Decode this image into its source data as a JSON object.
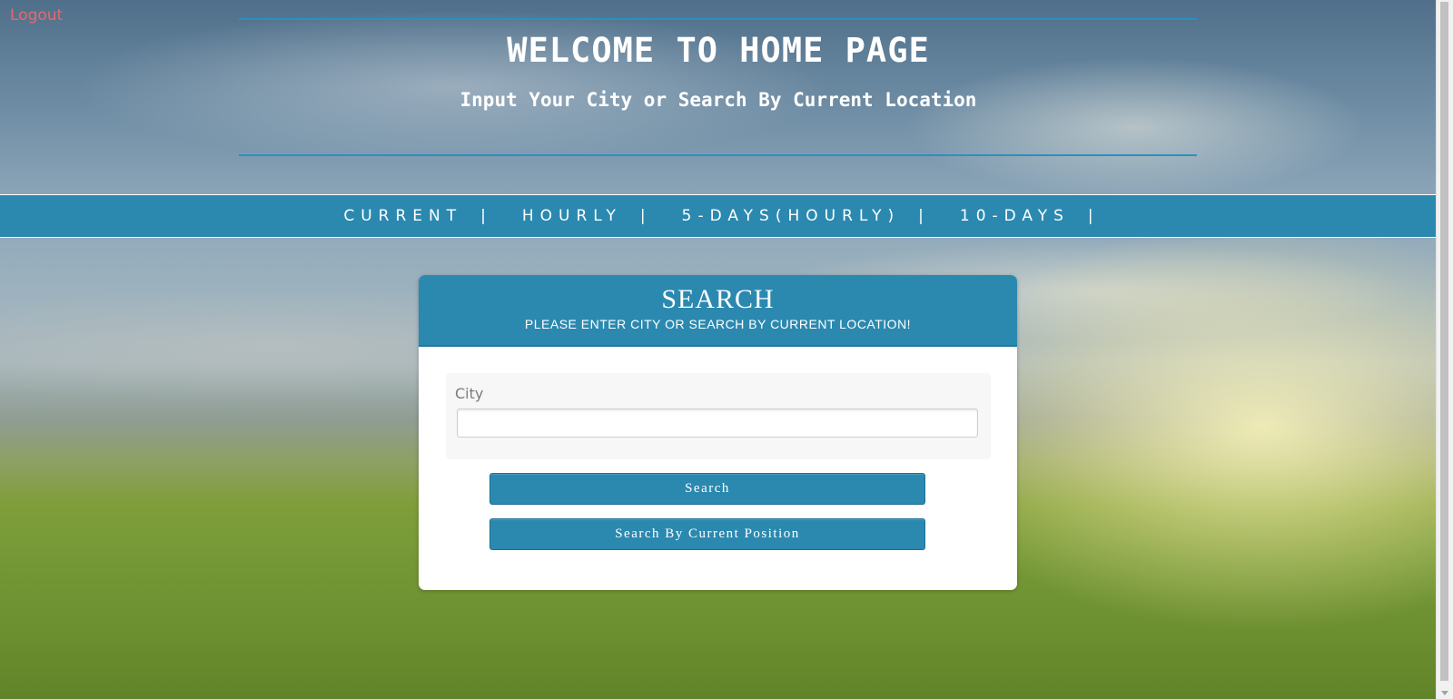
{
  "header": {
    "logout_label": "Logout",
    "title": "WELCOME TO HOME PAGE",
    "subtitle": "Input Your City or Search By Current Location"
  },
  "nav": {
    "items": [
      {
        "label": "CURRENT",
        "separator": "|"
      },
      {
        "label": "HOURLY",
        "separator": "|"
      },
      {
        "label": "5-DAYS(HOURLY)",
        "separator": "|"
      },
      {
        "label": "10-DAYS",
        "separator": "|"
      }
    ]
  },
  "search_card": {
    "title": "SEARCH",
    "subtitle": "PLEASE ENTER CITY OR SEARCH BY CURRENT LOCATION!",
    "city_label": "City",
    "city_value": "",
    "search_button": "Search",
    "position_button": "Search By Current Position"
  },
  "colors": {
    "accent": "#2b89b0",
    "logout": "#e9686c",
    "rule": "#2a90c2"
  }
}
